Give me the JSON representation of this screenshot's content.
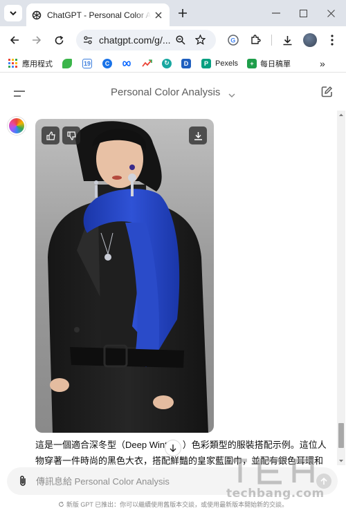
{
  "browser": {
    "tab": {
      "title": "ChatGPT - Personal Color Ana"
    },
    "address": {
      "url": "chatgpt.com/g/..."
    },
    "bookmarks": [
      {
        "label": "應用程式",
        "icon": "apps-grid-icon"
      },
      {
        "label": "",
        "icon": "green-leaf-icon"
      },
      {
        "label": "",
        "icon": "calendar-19-icon"
      },
      {
        "label": "",
        "icon": "c-logo-icon"
      },
      {
        "label": "",
        "icon": "meta-infinity-icon"
      },
      {
        "label": "",
        "icon": "trend-arrow-icon"
      },
      {
        "label": "",
        "icon": "circular-arrow-icon"
      },
      {
        "label": "",
        "icon": "d-square-icon"
      },
      {
        "label": "Pexels",
        "icon": "pexels-icon"
      },
      {
        "label": "每日稿單",
        "icon": "plus-square-icon"
      }
    ]
  },
  "chat": {
    "title": "Personal Color Analysis",
    "message": {
      "lines": [
        "這是一個適合深冬型（Deep Wint",
        "）色彩類型的服裝搭配示例。這位人",
        "物穿著一件時尚的黑色大衣，搭配鮮豔的皇家藍圍巾，並配有銀色耳環和"
      ]
    },
    "composer": {
      "placeholder": "傳訊息給 Personal Color Analysis"
    },
    "footer": {
      "text": "新版 GPT 已推出：你可以繼續使用舊版本交談，或使用最新版本開始新的交談。"
    }
  },
  "watermark": {
    "text": "techbang.com"
  },
  "colors": {
    "scarf_blue": "#1f3fbf",
    "coat_black": "#1c1c1c",
    "tab_strip": "#dfe3ea"
  }
}
